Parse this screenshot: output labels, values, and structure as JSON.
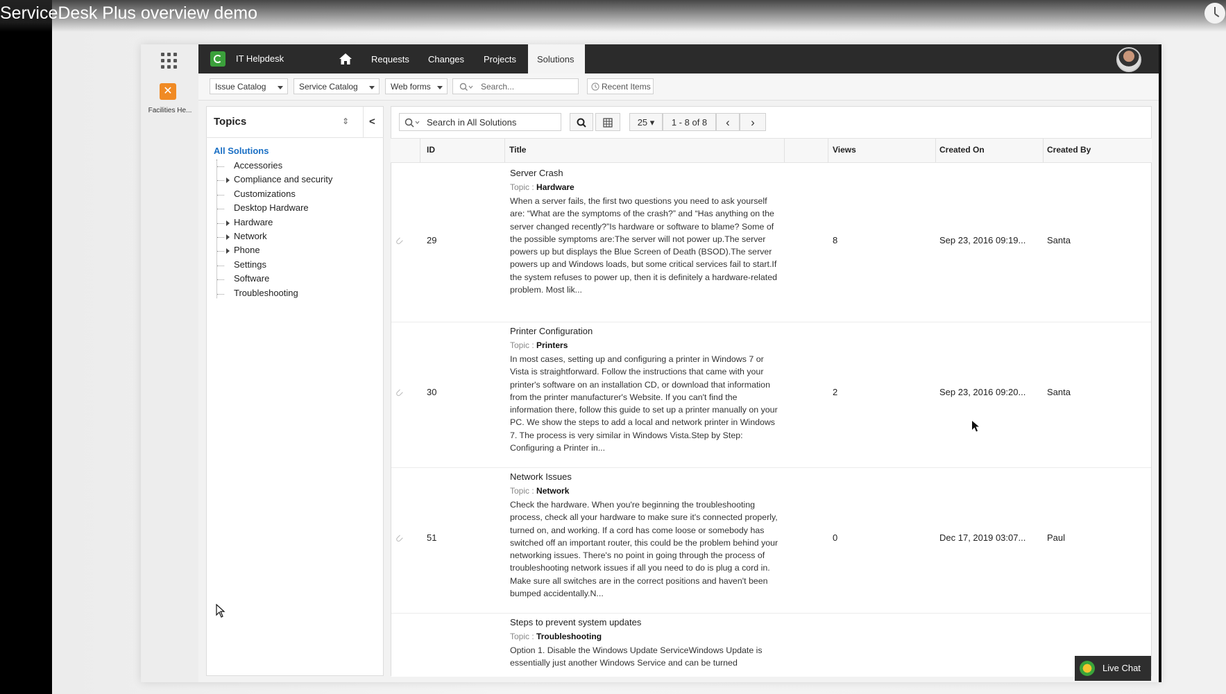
{
  "video": {
    "title": "ServiceDesk Plus overview demo",
    "clock_icon": "clock-icon"
  },
  "rail": {
    "facilities_label": "Facilities He...",
    "apps_icon": "apps-grid-icon",
    "facilities_icon": "tools-icon"
  },
  "nav": {
    "app_name": "IT Helpdesk",
    "items": [
      "Requests",
      "Changes",
      "Projects",
      "Solutions"
    ],
    "active": "Solutions",
    "home_icon": "home-icon"
  },
  "toolbar": {
    "dropdowns": [
      "Issue Catalog",
      "Service Catalog",
      "Web forms"
    ],
    "search_placeholder": "Search...",
    "recent_label": "Recent Items"
  },
  "topics": {
    "title": "Topics",
    "all_label": "All Solutions",
    "items": [
      {
        "label": "Accessories",
        "expandable": false
      },
      {
        "label": "Compliance and security",
        "expandable": true
      },
      {
        "label": "Customizations",
        "expandable": false
      },
      {
        "label": "Desktop Hardware",
        "expandable": false
      },
      {
        "label": "Hardware",
        "expandable": true
      },
      {
        "label": "Network",
        "expandable": true
      },
      {
        "label": "Phone",
        "expandable": true
      },
      {
        "label": "Settings",
        "expandable": false
      },
      {
        "label": "Software",
        "expandable": false
      },
      {
        "label": "Troubleshooting",
        "expandable": false
      }
    ]
  },
  "list": {
    "search_placeholder": "Search in All Solutions",
    "per_page": "25",
    "range": "1 - 8 of 8",
    "columns": {
      "id": "ID",
      "title": "Title",
      "views": "Views",
      "created_on": "Created On",
      "created_by": "Created By"
    },
    "topic_prefix": "Topic :",
    "rows": [
      {
        "id": "29",
        "title": "Server Crash",
        "topic": "Hardware",
        "desc": "When a server fails, the first two questions you need to ask yourself are: “What are the symptoms of the crash?” and “Has anything on the server changed recently?”Is hardware or software to blame? Some of the possible symptoms are:The server will not power up.The server powers up but displays the Blue Screen of Death (BSOD).The server powers up and Windows loads, but some critical services fail to start.If the system refuses to power up, then it is definitely a hardware-related problem. Most lik...",
        "views": "8",
        "created_on": "Sep 23, 2016 09:19...",
        "created_by": "Santa"
      },
      {
        "id": "30",
        "title": "Printer Configuration",
        "topic": "Printers",
        "desc": "In most cases, setting up and configuring a printer in Windows 7 or Vista is straightforward. Follow the instructions that came with your printer's software on an installation CD, or download that information from the printer manufacturer's Website. If you can't find the information there, follow this guide to set up a printer manually on your PC. We show the steps to add a local and network printer in Windows 7. The process is very similar in Windows Vista.Step by Step: Configuring a Printer in...",
        "views": "2",
        "created_on": "Sep 23, 2016 09:20...",
        "created_by": "Santa"
      },
      {
        "id": "51",
        "title": "Network Issues",
        "topic": "Network",
        "desc": "Check the hardware. When you're beginning the troubleshooting process, check all your hardware to make sure it's connected properly, turned on, and working. If a cord has come loose or somebody has switched off an important router, this could be the problem behind your networking issues. There's no point in going through the process of troubleshooting network issues if all you need to do is plug a cord in. Make sure all switches are in the correct positions and haven't been bumped accidentally.N...",
        "views": "0",
        "created_on": "Dec 17, 2019 03:07...",
        "created_by": "Paul"
      },
      {
        "id": "",
        "title": "Steps to prevent system updates",
        "topic": "Troubleshooting",
        "desc": "Option 1. Disable the Windows Update ServiceWindows Update is essentially just another Windows Service and can be turned",
        "views": "",
        "created_on": "",
        "created_by": ""
      }
    ]
  },
  "live_chat": "Live Chat"
}
